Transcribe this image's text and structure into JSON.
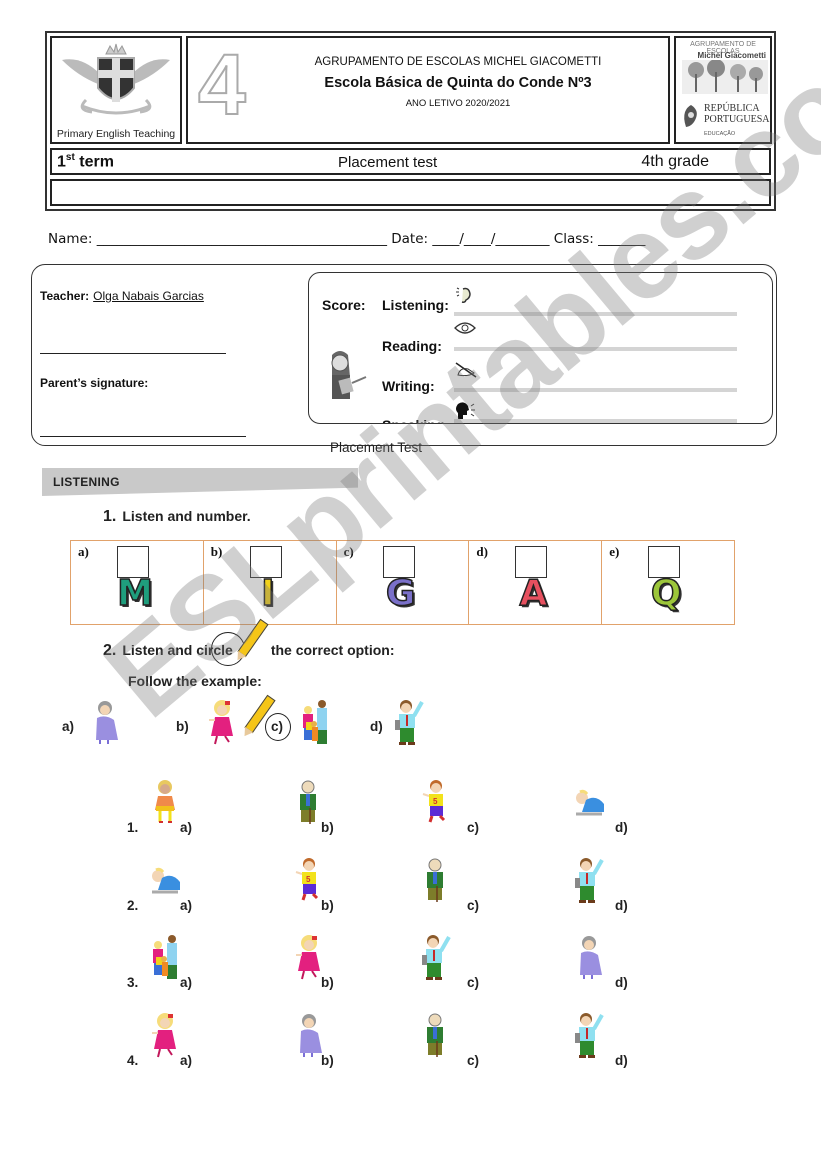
{
  "header": {
    "logo_caption": "Primary English Teaching",
    "grade_number": "4",
    "school_group": "AGRUPAMENTO DE ESCOLAS MICHEL GIACOMETTI",
    "school_name": "Escola Básica de Quinta do Conde Nº3",
    "school_year": "ANO LETIVO 2020/2021",
    "right_logo": {
      "line1": "AGRUPAMENTO DE ESCOLAS",
      "line2": "Michel Giacometti",
      "line3": "REPÚBLICA",
      "line4": "PORTUGUESA",
      "line5": "EDUCAÇÃO"
    },
    "term_number": "1",
    "term_suffix": "st",
    "term_word": " term",
    "test_type": "Placement test",
    "grade_label": "4th grade"
  },
  "student_row": {
    "name_label": "Name:",
    "date_label": "Date:",
    "class_label": "Class:",
    "name_blank": "___________________________________________",
    "date_blank": "____/____/________",
    "class_blank": "_______"
  },
  "info": {
    "teacher_label": "Teacher:",
    "teacher_name": "Olga Nabais Garcias",
    "parent_signature_label": "Parent’s signature:",
    "score_label": "Score:",
    "skills": [
      {
        "label": "Listening:",
        "icon": "ear-icon"
      },
      {
        "label": "Reading:",
        "icon": "eye-icon"
      },
      {
        "label": "Writing:",
        "icon": "writing-hand-icon"
      },
      {
        "label": "Speaking:",
        "icon": "speaking-head-icon"
      }
    ],
    "caption": "Placement Test"
  },
  "section": {
    "title": "LISTENING"
  },
  "question1": {
    "number": "1.",
    "instruction": "Listen and number.",
    "cells": [
      {
        "label": "a)",
        "letter": "M",
        "color": "#1f9e7d"
      },
      {
        "label": "b)",
        "letter": "I",
        "color": "#f2d21b"
      },
      {
        "label": "c)",
        "letter": "G",
        "color": "#7a70c9"
      },
      {
        "label": "d)",
        "letter": "A",
        "color": "#e6505f"
      },
      {
        "label": "e)",
        "letter": "Q",
        "color": "#9cc63a"
      }
    ]
  },
  "question2": {
    "number": "2.",
    "instruction_part1": "Listen and circle",
    "instruction_part2": "the correct option:",
    "follow": "Follow the example:",
    "example": [
      {
        "label": "a)",
        "figure": "grandmother"
      },
      {
        "label": "b)",
        "figure": "girl"
      },
      {
        "label": "c)",
        "figure": "family",
        "circled": true
      },
      {
        "label": "d)",
        "figure": "father"
      }
    ],
    "rows": [
      {
        "number": "1.",
        "options": [
          {
            "label": "a)",
            "figure": "sister"
          },
          {
            "label": "b)",
            "figure": "grandfather"
          },
          {
            "label": "c)",
            "figure": "boy"
          },
          {
            "label": "d)",
            "figure": "baby"
          }
        ]
      },
      {
        "number": "2.",
        "options": [
          {
            "label": "a)",
            "figure": "baby"
          },
          {
            "label": "b)",
            "figure": "boy"
          },
          {
            "label": "c)",
            "figure": "grandfather"
          },
          {
            "label": "d)",
            "figure": "father"
          }
        ]
      },
      {
        "number": "3.",
        "options": [
          {
            "label": "a)",
            "figure": "family"
          },
          {
            "label": "b)",
            "figure": "girl"
          },
          {
            "label": "c)",
            "figure": "father"
          },
          {
            "label": "d)",
            "figure": "grandmother"
          }
        ]
      },
      {
        "number": "4.",
        "options": [
          {
            "label": "a)",
            "figure": "girl"
          },
          {
            "label": "b)",
            "figure": "grandmother"
          },
          {
            "label": "c)",
            "figure": "grandfather"
          },
          {
            "label": "d)",
            "figure": "father"
          }
        ]
      }
    ]
  },
  "watermark": "ESLprintables.com"
}
